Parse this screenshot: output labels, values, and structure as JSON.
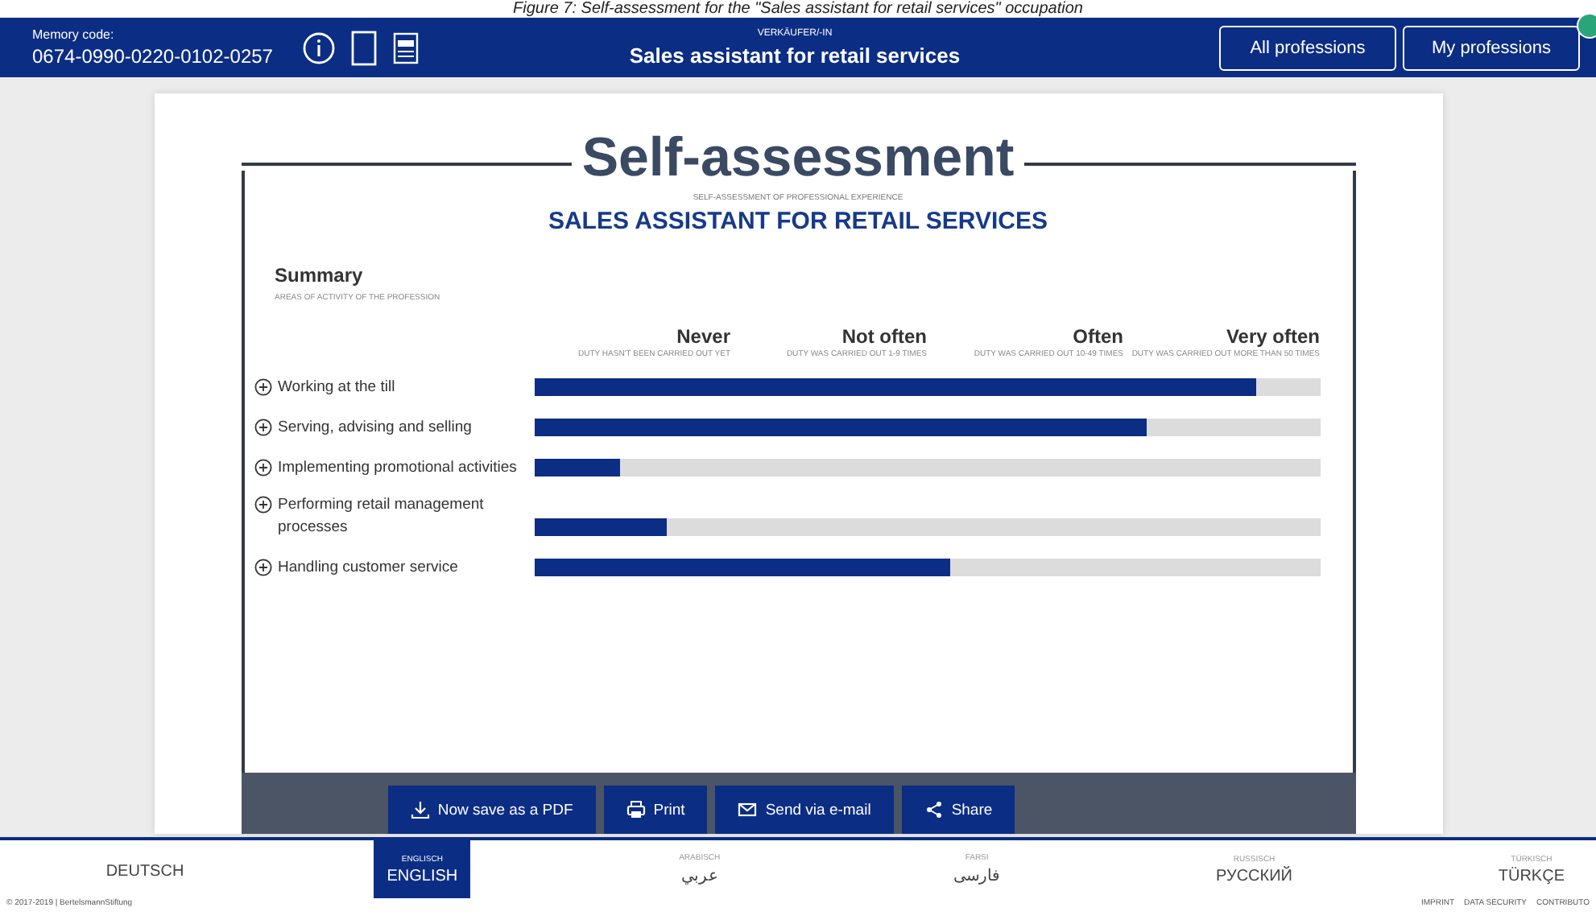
{
  "caption": "Figure 7: Self-assessment for the \"Sales assistant for retail services\" occupation",
  "header": {
    "memory_label": "Memory code:",
    "memory_code": "0674-0990-0220-0102-0257",
    "profession_de": "VERKÄUFER/-IN",
    "profession": "Sales assistant for retail services",
    "buttons": [
      "All professions",
      "My professions"
    ]
  },
  "document": {
    "title": "Self-assessment",
    "subtitle": "SELF-ASSESSMENT OF PROFESSIONAL EXPERIENCE",
    "heading": "SALES ASSISTANT FOR RETAIL SERVICES",
    "summary": "Summary",
    "summary_note": "AREAS OF ACTIVITY OF THE PROFESSION",
    "scale": [
      {
        "label": "Never",
        "note": "DUTY HASN'T BEEN CARRIED OUT YET"
      },
      {
        "label": "Not often",
        "note": "DUTY WAS CARRIED OUT 1-9 TIMES"
      },
      {
        "label": "Often",
        "note": "DUTY WAS CARRIED OUT 10-49 TIMES"
      },
      {
        "label": "Very often",
        "note": "DUTY WAS CARRIED OUT MORE THAN 50 TIMES"
      }
    ],
    "activities": [
      {
        "name": "Working at the till",
        "level": 0.92
      },
      {
        "name": "Serving, advising and selling",
        "level": 0.78
      },
      {
        "name": "Implementing promotional activities",
        "level": 0.11
      },
      {
        "name": "Performing retail management processes",
        "level": 0.17
      },
      {
        "name": "Handling customer service",
        "level": 0.53
      }
    ],
    "actions": [
      {
        "kind": "pdf",
        "label": "Now save as a PDF"
      },
      {
        "kind": "print",
        "label": "Print"
      },
      {
        "kind": "mail",
        "label": "Send via e-mail"
      },
      {
        "kind": "share",
        "label": "Share"
      }
    ]
  },
  "languages": [
    {
      "native": "DEUTSCH",
      "selected": false
    },
    {
      "german": "ENGLISCH",
      "native": "ENGLISH",
      "selected": true
    },
    {
      "german": "ARABISCH",
      "native": "عربي",
      "selected": false
    },
    {
      "german": "FARSI",
      "native": "فارسی",
      "selected": false
    },
    {
      "german": "RUSSISCH",
      "native": "РУССКИЙ",
      "selected": false
    },
    {
      "german": "TÜRKISCH",
      "native": "TÜRKÇE",
      "selected": false
    }
  ],
  "footer": {
    "copyright": "© 2017-2019 | BertelsmannStiftung",
    "links": [
      "IMPRINT",
      "DATA SECURITY",
      "CONTRIBUTO"
    ]
  }
}
